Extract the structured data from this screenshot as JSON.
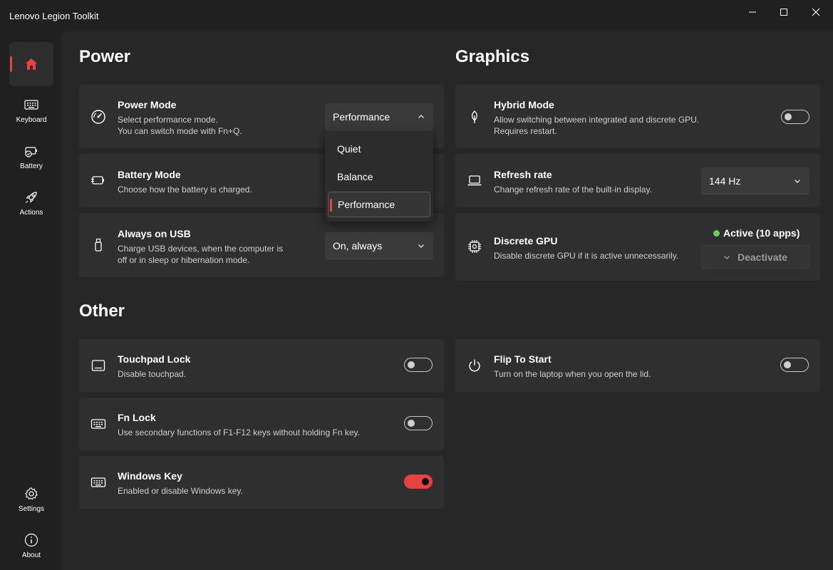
{
  "window": {
    "title": "Lenovo Legion Toolkit"
  },
  "sidebar": {
    "items": [
      {
        "icon": "home-icon",
        "label": ""
      },
      {
        "icon": "keyboard-icon",
        "label": "Keyboard"
      },
      {
        "icon": "battery-icon",
        "label": "Battery"
      },
      {
        "icon": "rocket-icon",
        "label": "Actions"
      },
      {
        "icon": "gear-icon",
        "label": "Settings"
      },
      {
        "icon": "info-icon",
        "label": "About"
      }
    ]
  },
  "power": {
    "section_title": "Power",
    "power_mode": {
      "title": "Power Mode",
      "desc_line1": "Select performance mode.",
      "desc_line2": "You can switch mode with Fn+Q.",
      "value": "Performance",
      "options": [
        "Quiet",
        "Balance",
        "Performance"
      ]
    },
    "battery_mode": {
      "title": "Battery Mode",
      "desc": "Choose how the battery is charged."
    },
    "always_on_usb": {
      "title": "Always on USB",
      "desc_line1": "Charge USB devices, when the computer is",
      "desc_line2": "off or in sleep or hibernation mode.",
      "value": "On, always"
    }
  },
  "graphics": {
    "section_title": "Graphics",
    "hybrid_mode": {
      "title": "Hybrid Mode",
      "desc_line1": "Allow switching between integrated and discrete GPU.",
      "desc_line2": "Requires restart.",
      "enabled": false
    },
    "refresh_rate": {
      "title": "Refresh rate",
      "desc": "Change refresh rate of the built-in display.",
      "value": "144 Hz"
    },
    "discrete_gpu": {
      "title": "Discrete GPU",
      "desc": "Disable discrete GPU if it is active unnecessarily.",
      "status": "Active (10 apps)",
      "status_color": "#6ccb5f",
      "button_label": "Deactivate"
    }
  },
  "other": {
    "section_title": "Other",
    "touchpad_lock": {
      "title": "Touchpad Lock",
      "desc": "Disable touchpad.",
      "enabled": false
    },
    "fn_lock": {
      "title": "Fn Lock",
      "desc": "Use secondary functions of F1-F12 keys without holding Fn key.",
      "enabled": false
    },
    "windows_key": {
      "title": "Windows Key",
      "desc": "Enabled or disable Windows key.",
      "enabled": true
    },
    "flip_to_start": {
      "title": "Flip To Start",
      "desc": "Turn on the laptop when you open the lid.",
      "enabled": false
    }
  },
  "colors": {
    "accent": "#e84141",
    "background": "#202020",
    "card": "#2f2f2f"
  }
}
